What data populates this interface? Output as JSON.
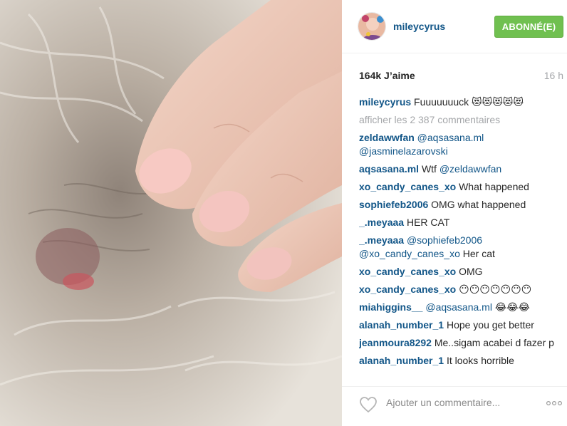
{
  "post": {
    "username": "mileycyrus",
    "follow_label": "ABONNÉ(E)",
    "likes": "164k J’aime",
    "time_ago": "16 h",
    "caption": {
      "user": "mileycyrus",
      "text": " Fuuuuuuuck 😻😻😻😻😻"
    },
    "view_all": "afficher les 2 387 commentaires",
    "add_comment_placeholder": "Ajouter un commentaire..."
  },
  "comments": [
    {
      "user": "zeldawwfan",
      "mention": " @aqsasana.ml @jasminelazarovski",
      "text": ""
    },
    {
      "user": "aqsasana.ml",
      "text": " Wtf ",
      "mention": "@zeldawwfan"
    },
    {
      "user": "xo_candy_canes_xo",
      "text": " What happened",
      "mention": ""
    },
    {
      "user": "sophiefeb2006",
      "text": " OMG what happened",
      "mention": ""
    },
    {
      "user": "_.meyaaa",
      "text": " HER CAT",
      "mention": ""
    },
    {
      "user": "_.meyaaa",
      "mention": " @sophiefeb2006 @xo_candy_canes_xo",
      "text": " Her cat"
    },
    {
      "user": "xo_candy_canes_xo",
      "text": " OMG",
      "mention": ""
    },
    {
      "user": "xo_candy_canes_xo",
      "text": " 😶😶😶😶😶😶😶",
      "mention": ""
    },
    {
      "user": "miahiggins__",
      "mention": " @aqsasana.ml",
      "text": " 😂😂😂"
    },
    {
      "user": "alanah_number_1",
      "text": " Hope you get better",
      "mention": ""
    },
    {
      "user": "jeanmoura8292",
      "text": " Me..sigam acabei d fazer p",
      "mention": ""
    },
    {
      "user": "alanah_number_1",
      "text": " It looks horrible",
      "mention": ""
    }
  ],
  "colors": {
    "link": "#125688",
    "follow_green": "#70c050",
    "muted": "#a5a7aa"
  },
  "icons": {
    "like": "heart-outline-icon",
    "more": "more-dots-icon"
  }
}
